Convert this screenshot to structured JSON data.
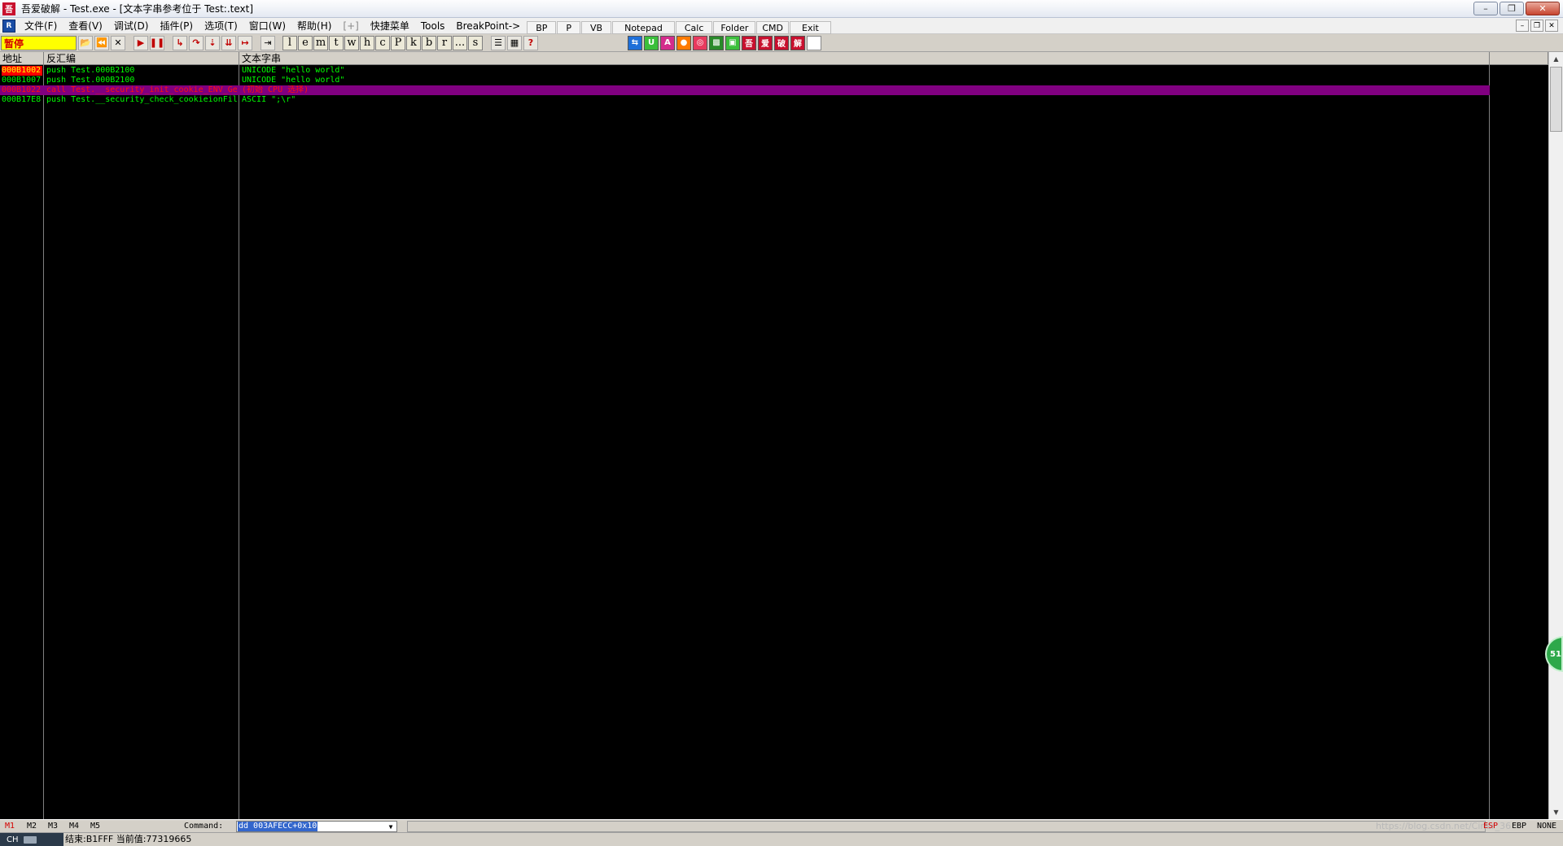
{
  "window": {
    "logo": "吾",
    "title": "吾爱破解 - Test.exe - [文本字串参考位于 Test:.text]",
    "min": "–",
    "max": "❐",
    "close": "✕"
  },
  "menu": {
    "app_icon": "R",
    "items": [
      "文件(F)",
      "查看(V)",
      "调试(D)",
      "插件(P)",
      "选项(T)",
      "窗口(W)",
      "帮助(H)",
      "[+]",
      "快捷菜单",
      "Tools",
      "BreakPoint->"
    ],
    "tool_buttons": [
      "BP",
      "P",
      "VB",
      "Notepad",
      "Calc",
      "Folder",
      "CMD",
      "Exit"
    ],
    "mdi": [
      "–",
      "❐",
      "✕"
    ]
  },
  "toolbar": {
    "status": "暂停",
    "icons": [
      "open-icon",
      "rewind-icon",
      "close-icon",
      "run-icon",
      "pause-icon",
      "step-into-icon",
      "step-over-icon",
      "trace-into-icon",
      "trace-over-icon",
      "execute-till-return-icon",
      "goto-icon"
    ],
    "letters": [
      "l",
      "e",
      "m",
      "t",
      "w",
      "h",
      "c",
      "P",
      "k",
      "b",
      "r",
      "...",
      "s"
    ],
    "right_icons": [
      "list-icon",
      "window-icon",
      "help-icon"
    ],
    "plugins": [
      "吾",
      "爱",
      "破",
      "解"
    ],
    "colors": {
      "blue": "#1e6fd9",
      "green": "#2ea84a",
      "magenta": "#d42c8c",
      "orange": "#ff7a00",
      "pink": "#e83a5e",
      "dkgreen": "#2a8a2a",
      "lime": "#3bbf3b",
      "brand": "#c8102e"
    }
  },
  "panel": {
    "headers": {
      "address": "地址",
      "disasm": "反汇编",
      "text": "文本字串"
    },
    "rows": [
      {
        "address": "000B1002",
        "disasm": "push Test.000B2100",
        "text": "UNICODE \"hello world\"",
        "style": "first"
      },
      {
        "address": "000B1007",
        "disasm": "push Test.000B2100",
        "text": "UNICODE \"hello world\"",
        "style": "normal"
      },
      {
        "address": "000B1022",
        "disasm": "call Test.__security_init_cookie_ENV_GetExt",
        "text": "(初始 CPU 选择)",
        "style": "selected"
      },
      {
        "address": "000B17E8",
        "disasm": "push Test.__security_check_cookieionFil",
        "text": "ASCII \";\\r\"",
        "style": "normal"
      }
    ]
  },
  "float_badge": "51",
  "cmdbar": {
    "tabs": [
      "M1",
      "M2",
      "M3",
      "M4",
      "M5"
    ],
    "label": "Command:",
    "value": "dd 003AFECC+0x10",
    "watermark": "https://blog.csdn.net/Ciner_36",
    "registers": [
      "ESP",
      "EBP",
      "NONE"
    ]
  },
  "statusbar": {
    "ime": "CH",
    "text": "结束:B1FFF 当前值:77319665"
  }
}
